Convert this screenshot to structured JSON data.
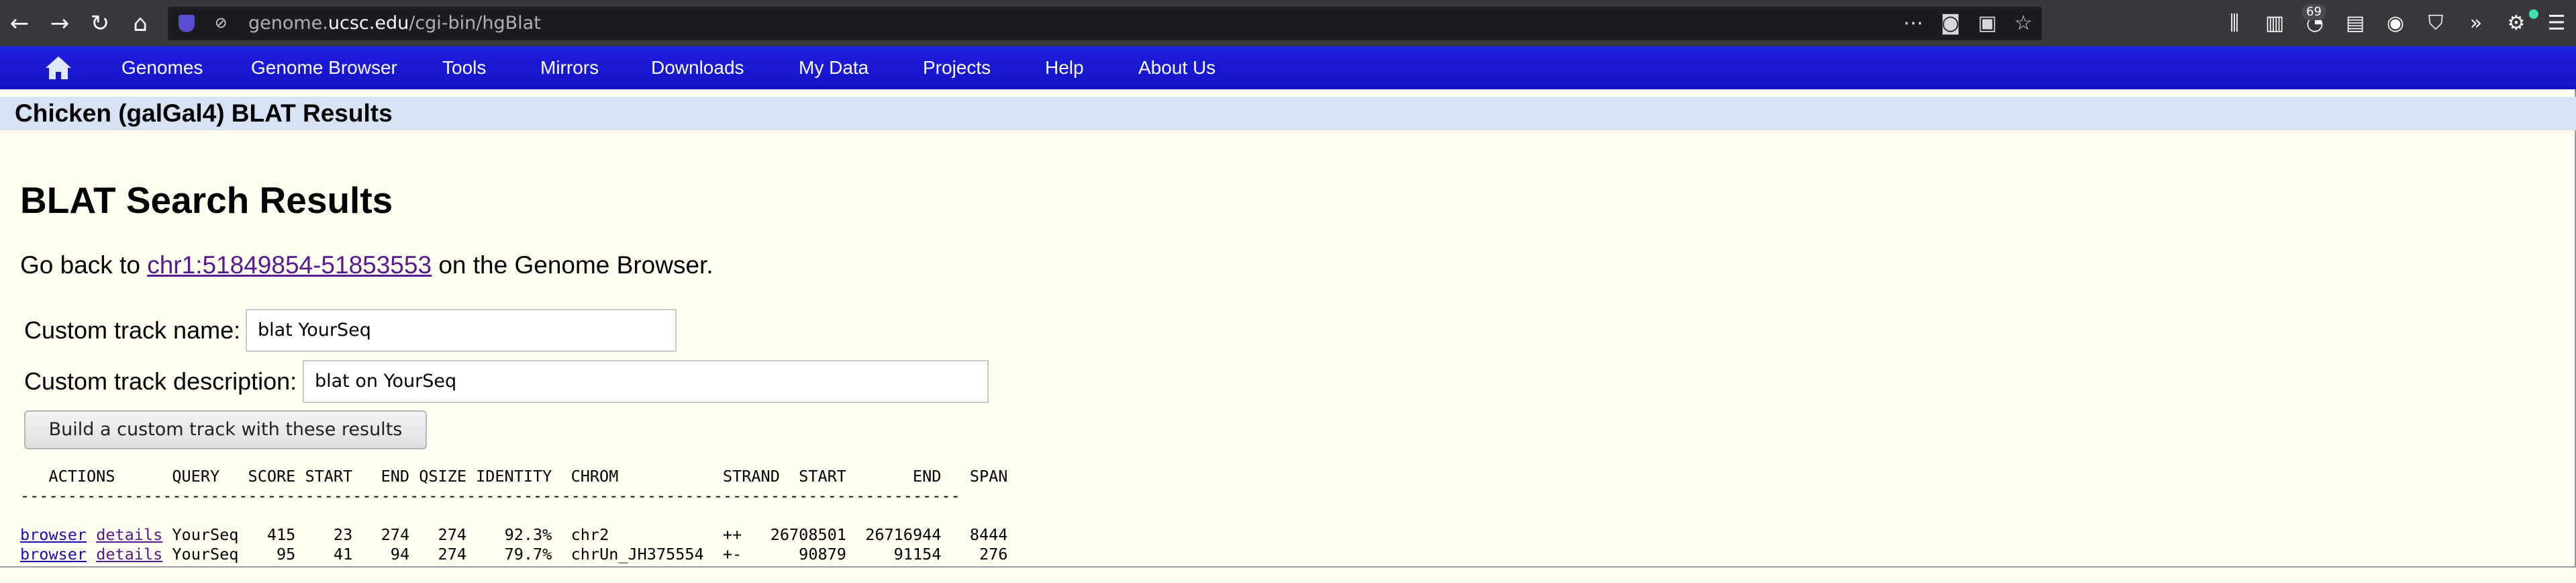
{
  "browser": {
    "url_host_prefix": "genome.",
    "url_host": "ucsc.edu",
    "url_path": "/cgi-bin/hgBlat",
    "badge_count": "69"
  },
  "nav": {
    "items": [
      "Genomes",
      "Genome Browser",
      "Tools",
      "Mirrors",
      "Downloads",
      "My Data",
      "Projects",
      "Help",
      "About Us"
    ]
  },
  "page": {
    "title": "Chicken (galGal4) BLAT Results",
    "heading": "BLAT Search Results",
    "goback_prefix": "Go back to ",
    "goback_link": "chr1:51849854-51853553",
    "goback_suffix": " on the Genome Browser."
  },
  "form": {
    "track_name_label": "Custom track name:",
    "track_name_value": "blat YourSeq",
    "track_desc_label": "Custom track description:",
    "track_desc_value": "blat on YourSeq",
    "build_button": "Build a custom track with these results"
  },
  "results": {
    "header": "   ACTIONS      QUERY   SCORE START   END QSIZE IDENTITY  CHROM           STRAND  START       END   SPAN",
    "divider": "---------------------------------------------------------------------------------------------------",
    "browser_label": "browser",
    "details_label": "details",
    "rows": [
      {
        "rest": " YourSeq   415    23   274   274    92.3%  chr2            ++   26708501  26716944   8444"
      },
      {
        "rest": " YourSeq    95    41    94   274    79.7%  chrUn_JH375554  +-      90879     91154    276"
      }
    ]
  }
}
